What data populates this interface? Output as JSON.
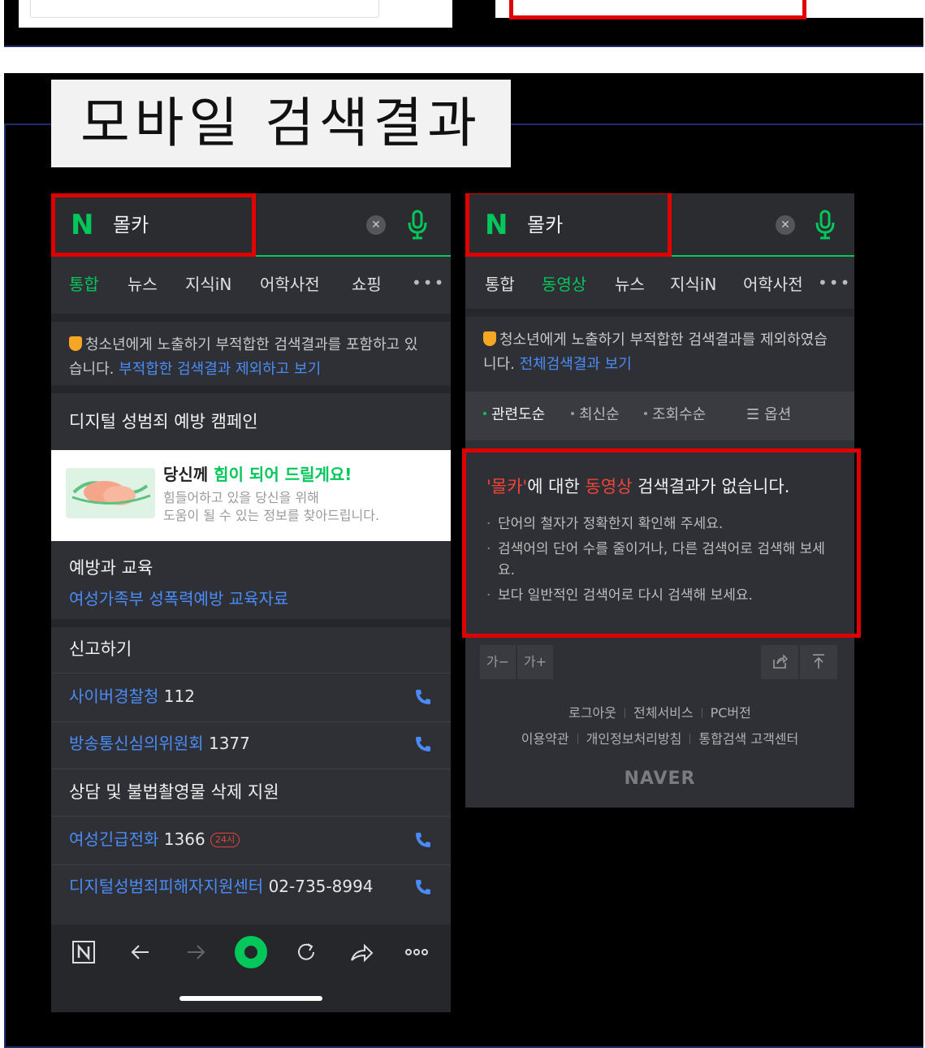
{
  "slide": {
    "title": "모바일 검색결과"
  },
  "colors": {
    "naver_green": "#03c75a",
    "link_blue": "#4a8cf7",
    "highlight_red": "#e00000",
    "dark_bg": "#2f3035"
  },
  "phone_left": {
    "search": {
      "logo": "N",
      "query": "몰카",
      "clear_icon": "x-icon",
      "mic_icon": "mic-icon"
    },
    "tabs": [
      {
        "label": "통합",
        "active": true
      },
      {
        "label": "뉴스",
        "active": false
      },
      {
        "label": "지식iN",
        "active": false
      },
      {
        "label": "어학사전",
        "active": false
      },
      {
        "label": "쇼핑",
        "active": false
      }
    ],
    "more_label": "•••",
    "notice": {
      "text": "청소년에게 노출하기 부적합한 검색결과를 포함하고 있습니다.",
      "link": "부적합한 검색결과 제외하고 보기"
    },
    "campaign": {
      "heading": "디지털 성범죄 예방 캠페인",
      "title_prefix": "당신께",
      "title_highlight": "힘이 되어 드릴게요!",
      "subtitle_1": "힘들어하고 있을 당신을 위해",
      "subtitle_2": "도움이 될 수 있는 정보를 찾아드립니다."
    },
    "education": {
      "heading": "예방과 교육",
      "link": "여성가족부 성폭력예방 교육자료"
    },
    "report": {
      "heading": "신고하기",
      "rows": [
        {
          "name": "사이버경찰청",
          "number": "112"
        },
        {
          "name": "방송통신심의위원회",
          "number": "1377"
        }
      ]
    },
    "support": {
      "heading": "상담 및 불법촬영물 삭제 지원",
      "rows": [
        {
          "name": "여성긴급전화",
          "number": "1366",
          "badge": "24시"
        },
        {
          "name": "디지털성범죄피해자지원센터",
          "number": "02-735-8994"
        }
      ]
    },
    "bottom_nav": [
      "naver-home-icon",
      "back-arrow-icon",
      "forward-arrow-icon",
      "green-dot-icon",
      "refresh-icon",
      "share-icon",
      "more-icon"
    ]
  },
  "phone_right": {
    "search": {
      "logo": "N",
      "query": "몰카"
    },
    "tabs": [
      {
        "label": "통합",
        "active": false
      },
      {
        "label": "동영상",
        "active": true
      },
      {
        "label": "뉴스",
        "active": false
      },
      {
        "label": "지식iN",
        "active": false
      },
      {
        "label": "어학사전",
        "active": false
      }
    ],
    "more_label": "•••",
    "notice": {
      "text": "청소년에게 노출하기 부적합한 검색결과를 제외하였습니다.",
      "link": "전체검색결과 보기"
    },
    "sorts": [
      {
        "label": "관련도순",
        "active": true
      },
      {
        "label": "최신순",
        "active": false
      },
      {
        "label": "조회수순",
        "active": false
      }
    ],
    "options_label": "옵션",
    "no_result": {
      "query_quoted": "'몰카'",
      "mid1": "에 대한 ",
      "category": "동영상",
      "mid2": " 검색결과가 없습니다.",
      "tips": [
        "단어의 철자가 정확한지 확인해 주세요.",
        "검색어의 단어 수를 줄이거나, 다른 검색어로 검색해 보세요.",
        "보다 일반적인 검색어로 다시 검색해 보세요."
      ]
    },
    "font_minus": "가−",
    "font_plus": "가+",
    "footer_row1": [
      "로그아웃",
      "전체서비스",
      "PC버전"
    ],
    "footer_row2": [
      "이용약관",
      "개인정보처리방침",
      "통합검색 고객센터"
    ],
    "brand": "NAVER"
  }
}
